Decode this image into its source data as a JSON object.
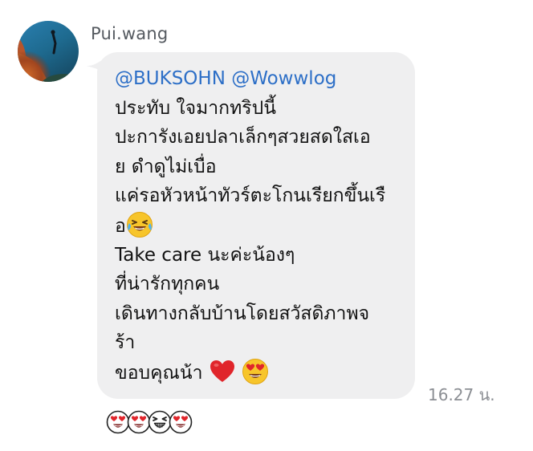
{
  "message": {
    "sender": "Pui.wang",
    "mention_1": "@BUKSOHN",
    "mention_2": "@Wowwlog",
    "lines": [
      "ประทับ ใจมากทริปนี้",
      "ปะการังเอยปลาเล็กๆสวยสดใสเอ",
      "ย ดำดูไม่เบื่อ",
      "แค่รอหัวหน้าทัวร์ตะโกนเรียกขึ้นเรื",
      "อ",
      "Take care นะค่ะน้องๆ",
      "ที่น่ารักทุกคน",
      "เดินทางกลับบ้านโดยสวัสดิภาพจ",
      "ร้า",
      "ขอบคุณน้า"
    ],
    "inline_emoji": {
      "line_4": "laughing-crying-face-icon",
      "line_9_a": "red-heart-icon",
      "line_9_b": "heart-eyes-face-icon"
    },
    "timestamp": "16.27 น."
  },
  "reactions": [
    {
      "icon": "heart-eyes-reaction-icon"
    },
    {
      "icon": "heart-eyes-reaction-icon"
    },
    {
      "icon": "grinning-squint-reaction-icon"
    },
    {
      "icon": "heart-eyes-reaction-icon"
    }
  ],
  "colors": {
    "bubble": "#efeff0",
    "mention": "#2d6fc7",
    "text": "#111111",
    "sender": "#555a60",
    "timestamp": "#8c8f94"
  }
}
